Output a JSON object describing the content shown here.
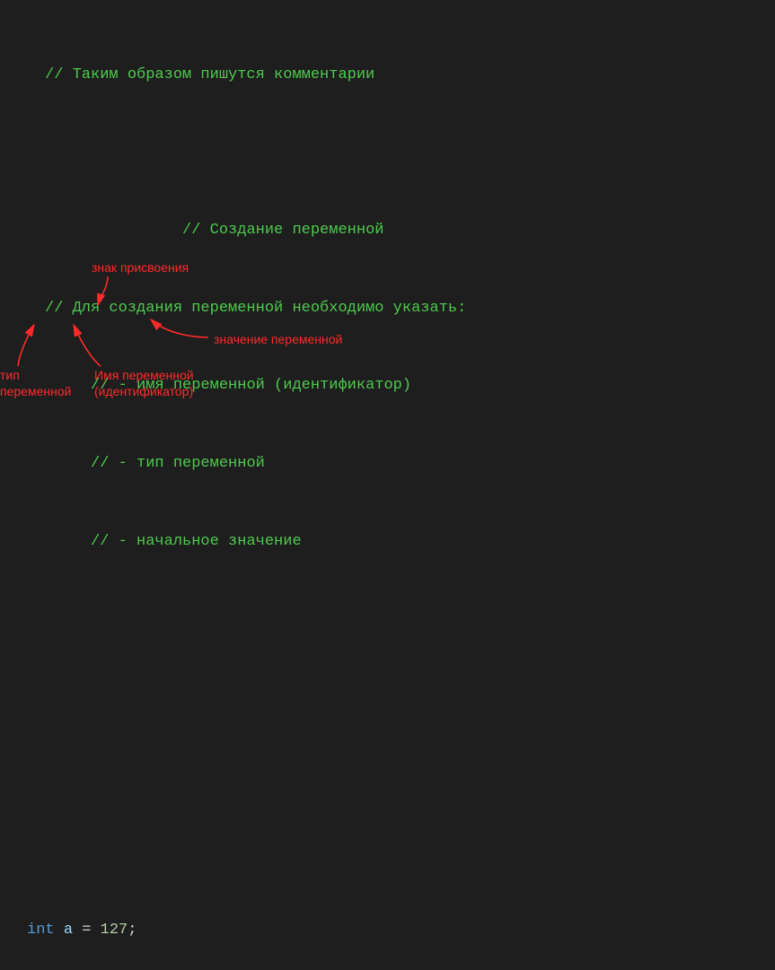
{
  "code": {
    "line1": "// Таким образом пишутся комментарии",
    "line2": "// Создание переменной",
    "line3": "// Для создания переменной необходимо указать:",
    "line4": "// - имя переменной (идентификатор)",
    "line5": "// - тип переменной",
    "line6": "// - начальное значение",
    "decl_keyword": "int",
    "decl_var": "a",
    "decl_op": "=",
    "decl_value": "127",
    "decl_semi": ";"
  },
  "annotations": {
    "assign": "знак присвоения",
    "value": "значение переменной",
    "type_l1": "тип",
    "type_l2": "переменной",
    "name_l1": "Имя переменной",
    "name_l2": "(идентификатор)"
  },
  "colors": {
    "bg": "#1e1e1e",
    "comment": "#4ec94e",
    "keyword": "#569cd6",
    "variable": "#9cdcfe",
    "number": "#b5cea8",
    "text": "#d4d4d4",
    "annotation": "#ff2a2a"
  }
}
